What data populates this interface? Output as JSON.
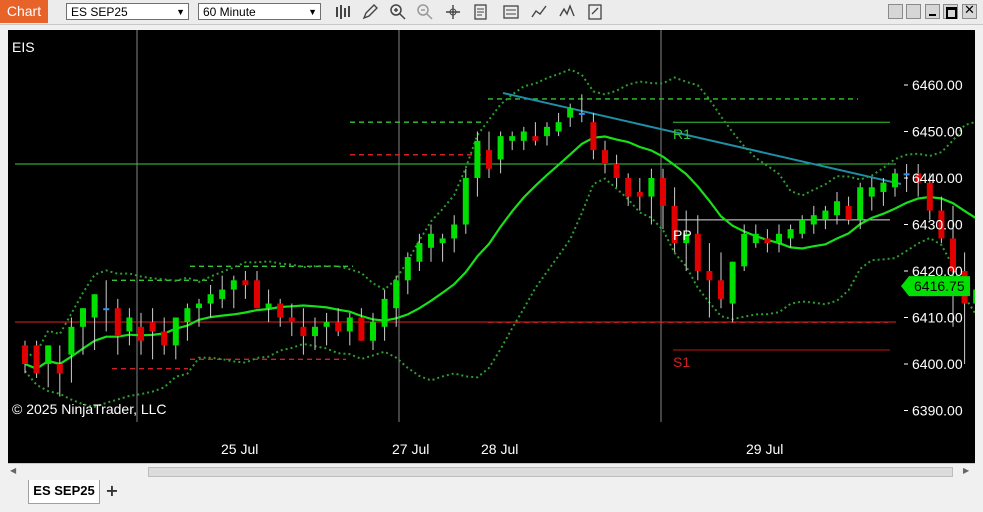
{
  "window": {
    "title": "Chart"
  },
  "toolbar": {
    "instrument": "ES SEP25",
    "interval": "60 Minute"
  },
  "chart": {
    "label": "EIS",
    "copyright": "© 2025 NinjaTrader, LLC",
    "price_axis": [
      "6460.00",
      "6450.00",
      "6440.00",
      "6430.00",
      "6420.00",
      "6410.00",
      "6400.00",
      "6390.00"
    ],
    "current_price": "6416.75",
    "time_axis": [
      "25 Jul",
      "27 Jul",
      "28 Jul",
      "29 Jul"
    ],
    "pivot_labels": {
      "r1": "R1",
      "pp": "PP",
      "s1": "S1"
    },
    "colors": {
      "up": "#00e000",
      "down": "#e00000",
      "doji": "#3a8df0",
      "ma": "#18e018",
      "band": "#2d9e2d",
      "trend": "#1f8fa6",
      "pivot_r": "#35c635",
      "pivot_s": "#d42020"
    }
  },
  "tabs": [
    {
      "label": "ES SEP25"
    }
  ],
  "chart_data": {
    "type": "candlestick",
    "y_axis_range": [
      6386,
      6468
    ],
    "candles": [
      [
        6404,
        6405,
        6398,
        6400
      ],
      [
        6404,
        6405,
        6397,
        6398
      ],
      [
        6400,
        6404,
        6395,
        6404
      ],
      [
        6400,
        6404,
        6393,
        6398
      ],
      [
        6402,
        6410,
        6396,
        6408
      ],
      [
        6408,
        6412,
        6402,
        6412
      ],
      [
        6410,
        6415,
        6403,
        6415
      ],
      [
        6412,
        6418,
        6407,
        6412
      ],
      [
        6412,
        6414,
        6402,
        6406
      ],
      [
        6407,
        6412,
        6404,
        6410
      ],
      [
        6408,
        6411,
        6402,
        6405
      ],
      [
        6409,
        6412,
        6401,
        6407
      ],
      [
        6407,
        6410,
        6402,
        6404
      ],
      [
        6404,
        6410,
        6401,
        6410
      ],
      [
        6409,
        6413,
        6405,
        6412
      ],
      [
        6412,
        6414,
        6408,
        6413
      ],
      [
        6413,
        6417,
        6410,
        6415
      ],
      [
        6414,
        6419,
        6412,
        6416
      ],
      [
        6416,
        6419,
        6412,
        6418
      ],
      [
        6418,
        6420,
        6414,
        6417
      ],
      [
        6418,
        6420,
        6412,
        6412
      ],
      [
        6412,
        6416,
        6409,
        6413
      ],
      [
        6413,
        6414,
        6408,
        6410
      ],
      [
        6410,
        6413,
        6406,
        6409
      ],
      [
        6408,
        6412,
        6402,
        6406
      ],
      [
        6406,
        6410,
        6403,
        6408
      ],
      [
        6408,
        6411,
        6404,
        6409
      ],
      [
        6409,
        6412,
        6406,
        6407
      ],
      [
        6407,
        6411,
        6404,
        6410
      ],
      [
        6410,
        6412,
        6405,
        6405
      ],
      [
        6405,
        6411,
        6403,
        6409
      ],
      [
        6408,
        6416,
        6405,
        6414
      ],
      [
        6412,
        6419,
        6408,
        6418
      ],
      [
        6418,
        6424,
        6415,
        6423
      ],
      [
        6422,
        6428,
        6420,
        6426
      ],
      [
        6425,
        6430,
        6422,
        6428
      ],
      [
        6426,
        6428,
        6422,
        6427
      ],
      [
        6427,
        6432,
        6424,
        6430
      ],
      [
        6430,
        6442,
        6428,
        6440
      ],
      [
        6440,
        6450,
        6436,
        6448
      ],
      [
        6446,
        6450,
        6440,
        6442
      ],
      [
        6444,
        6450,
        6441,
        6449
      ],
      [
        6448,
        6450,
        6446,
        6449
      ],
      [
        6448,
        6451,
        6446,
        6450
      ],
      [
        6449,
        6452,
        6447,
        6448
      ],
      [
        6449,
        6452,
        6447,
        6451
      ],
      [
        6450,
        6454,
        6449,
        6452
      ],
      [
        6453,
        6456,
        6451,
        6455
      ],
      [
        6454,
        6458,
        6452,
        6454
      ],
      [
        6452,
        6454,
        6444,
        6446
      ],
      [
        6446,
        6448,
        6441,
        6443
      ],
      [
        6443,
        6445,
        6438,
        6440
      ],
      [
        6440,
        6441,
        6434,
        6436
      ],
      [
        6437,
        6440,
        6433,
        6436
      ],
      [
        6436,
        6442,
        6430,
        6440
      ],
      [
        6440,
        6442,
        6429,
        6434
      ],
      [
        6434,
        6438,
        6424,
        6426
      ],
      [
        6426,
        6433,
        6420,
        6428
      ],
      [
        6428,
        6432,
        6418,
        6420
      ],
      [
        6420,
        6426,
        6410,
        6418
      ],
      [
        6418,
        6424,
        6412,
        6414
      ],
      [
        6413,
        6422,
        6409,
        6422
      ],
      [
        6421,
        6430,
        6420,
        6428
      ],
      [
        6426,
        6430,
        6425,
        6428
      ],
      [
        6427,
        6429,
        6424,
        6426
      ],
      [
        6426,
        6430,
        6424,
        6428
      ],
      [
        6427,
        6430,
        6425,
        6429
      ],
      [
        6428,
        6432,
        6427,
        6431
      ],
      [
        6430,
        6434,
        6428,
        6432
      ],
      [
        6431,
        6434,
        6429,
        6433
      ],
      [
        6432,
        6437,
        6430,
        6435
      ],
      [
        6434,
        6436,
        6430,
        6431
      ],
      [
        6431,
        6439,
        6429,
        6438
      ],
      [
        6436,
        6440,
        6433,
        6438
      ],
      [
        6437,
        6440,
        6434,
        6439
      ],
      [
        6438,
        6442,
        6436,
        6441
      ],
      [
        6441,
        6443,
        6437,
        6441
      ],
      [
        6441,
        6443,
        6436,
        6439
      ],
      [
        6439,
        6441,
        6431,
        6433
      ],
      [
        6433,
        6436,
        6426,
        6427
      ],
      [
        6427,
        6434,
        6408,
        6420
      ],
      [
        6420,
        6424,
        6400,
        6413
      ],
      [
        6413,
        6414,
        6404,
        6416
      ],
      [
        6416,
        6418,
        6413,
        6418
      ]
    ]
  }
}
